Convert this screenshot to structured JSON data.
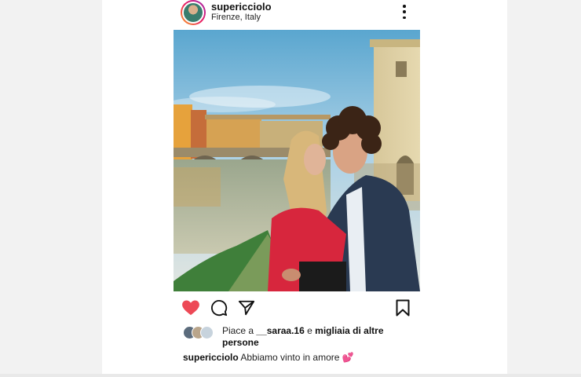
{
  "post": {
    "username": "supericciolo",
    "location": "Firenze, Italy",
    "likes": {
      "prefix": "Piace a",
      "liker": "__saraa.16",
      "conjunction": "e",
      "others": "migliaia di altre persone"
    },
    "caption": {
      "username": "supericciolo",
      "text": "Abbiamo vinto in amore",
      "emoji": "💕"
    }
  },
  "icons": {
    "menu": "more-vertical-icon",
    "like": "heart-icon",
    "comment": "comment-icon",
    "share": "send-icon",
    "save": "bookmark-icon"
  },
  "colors": {
    "like": "#ed4956",
    "text": "#111111",
    "background": "#f2f2f2",
    "card": "#ffffff"
  }
}
